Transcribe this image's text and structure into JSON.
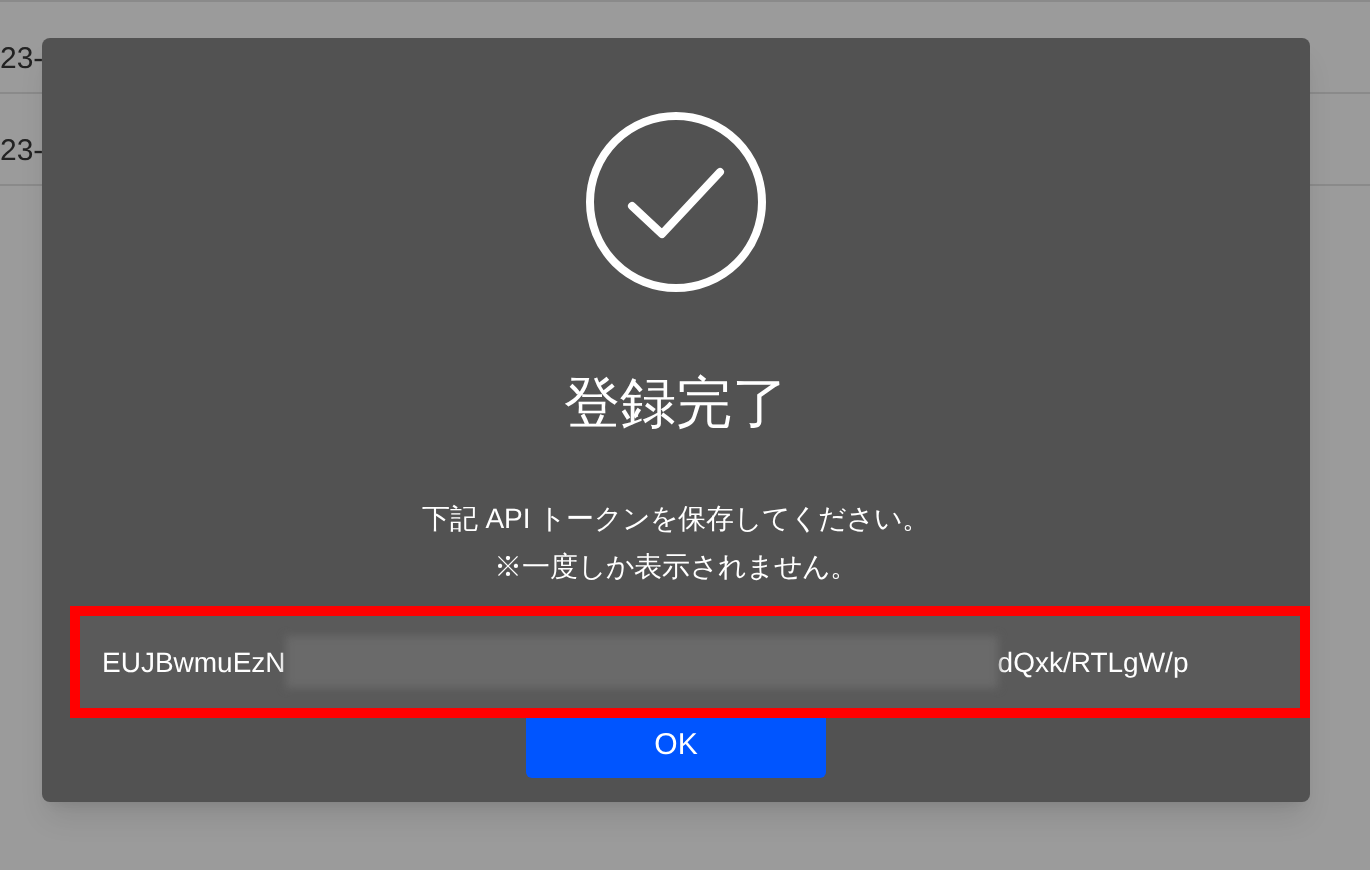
{
  "background_table": {
    "rows": [
      {
        "column_1": "23-"
      },
      {
        "column_1": "23-"
      }
    ]
  },
  "dialog": {
    "title": "登録完了",
    "message_lines": [
      "下記 API トークンを保存してください。",
      "※一度しか表示されません。"
    ],
    "token": {
      "start": "EUJBwmuEzN",
      "end": "dQxk/RTLgW/p"
    },
    "ok_button": "OK"
  }
}
